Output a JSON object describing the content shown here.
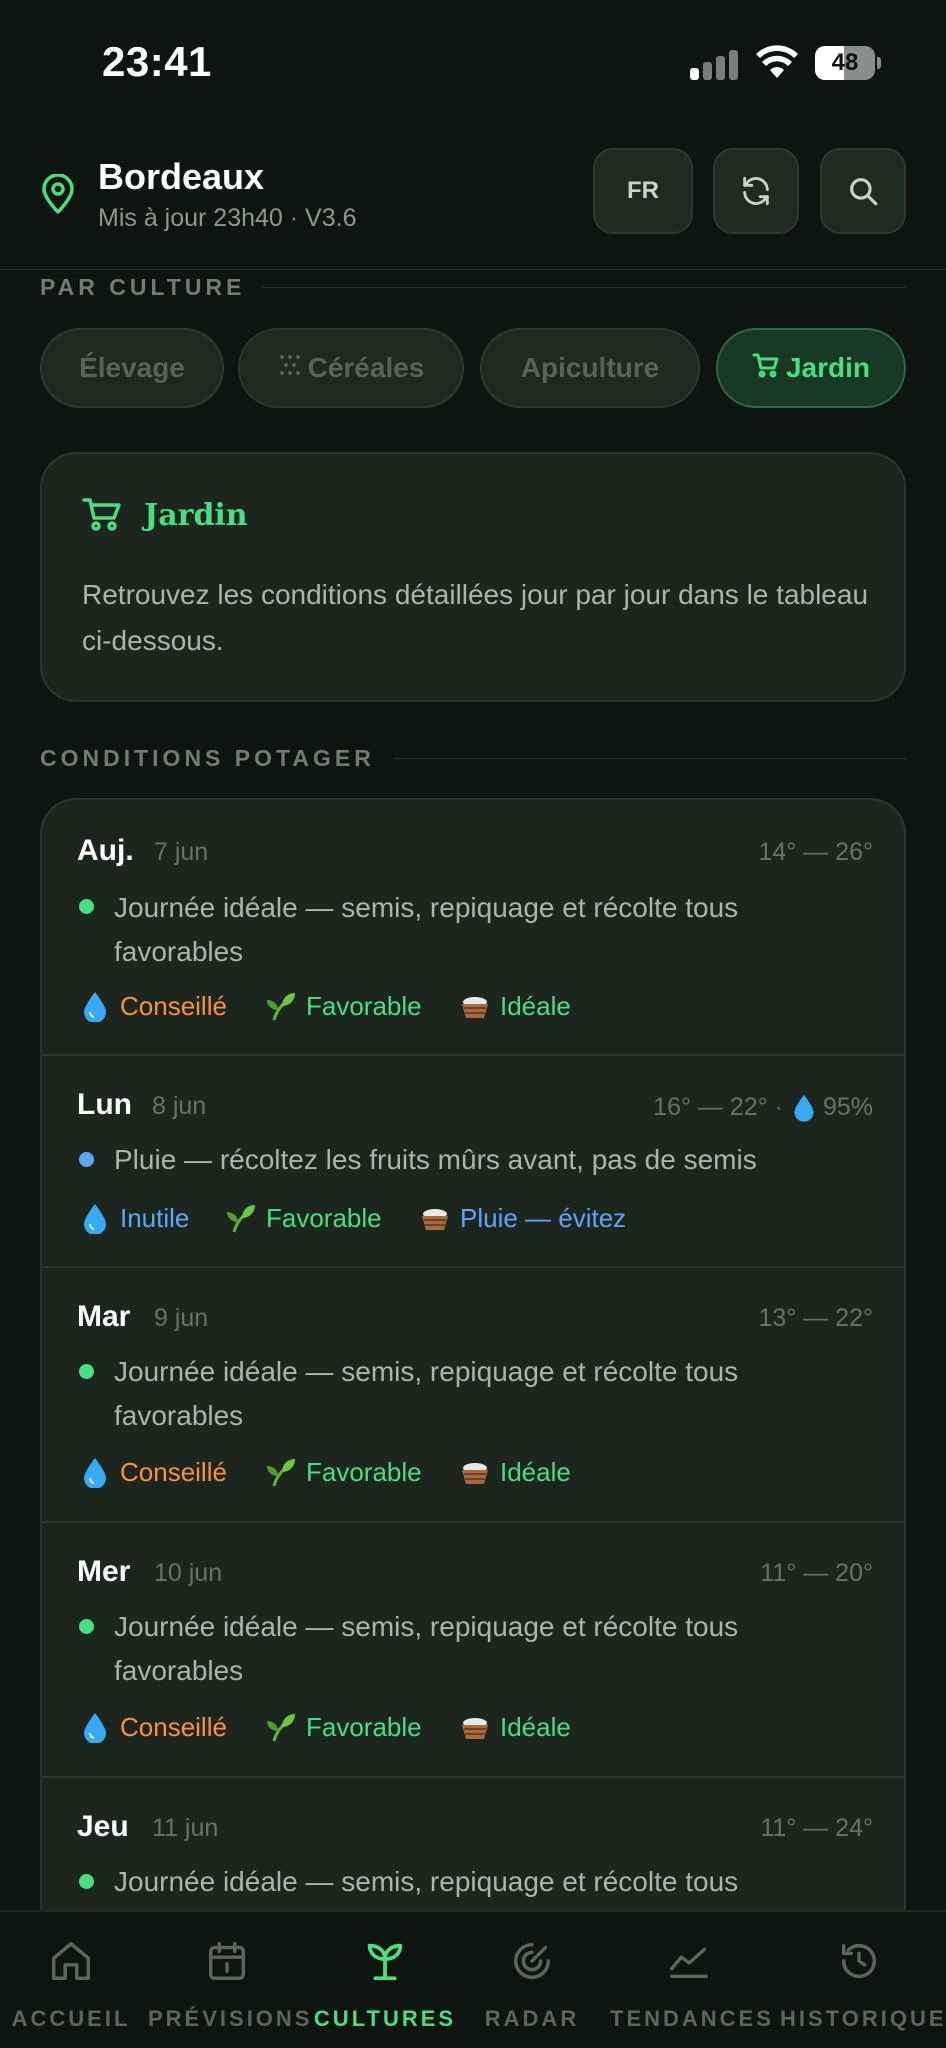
{
  "status": {
    "time": "23:41",
    "battery": "48",
    "battery_level": 0.48
  },
  "header": {
    "city": "Bordeaux",
    "updated": "Mis à jour 23h40 · V3.6",
    "lang": "FR"
  },
  "sections": {
    "by_culture": "PAR CULTURE",
    "garden_conditions": "CONDITIONS POTAGER"
  },
  "chips": [
    {
      "label": "Élevage",
      "icon": "",
      "active": false
    },
    {
      "label": "Céréales",
      "icon": "grain-icon",
      "active": false
    },
    {
      "label": "Apiculture",
      "icon": "",
      "active": false
    },
    {
      "label": "Jardin",
      "icon": "cart-icon",
      "active": true
    }
  ],
  "info": {
    "title": "Jardin",
    "icon": "wheelbarrow-icon",
    "description": "Retrouvez les conditions détaillées jour par jour dans le tableau ci-dessous."
  },
  "days": [
    {
      "day": "Auj.",
      "date": "7 jun",
      "temp": "14° — 26°",
      "rain": "",
      "status_color": "#4ade80",
      "summary": "Journée idéale — semis, repiquage et récolte tous favorables",
      "watering": "Conseillé",
      "watering_color": "#fb923c",
      "planting": "Favorable",
      "planting_color": "#4ade80",
      "harvest": "Idéale",
      "harvest_color": "#4ade80"
    },
    {
      "day": "Lun",
      "date": "8 jun",
      "temp": "16° — 22° ·",
      "rain": "95%",
      "status_color": "#60a5fa",
      "summary": "Pluie — récoltez les fruits mûrs avant, pas de semis",
      "watering": "Inutile",
      "watering_color": "#60a5fa",
      "planting": "Favorable",
      "planting_color": "#4ade80",
      "harvest": "Pluie — évitez",
      "harvest_color": "#60a5fa"
    },
    {
      "day": "Mar",
      "date": "9 jun",
      "temp": "13° — 22°",
      "rain": "",
      "status_color": "#4ade80",
      "summary": "Journée idéale — semis, repiquage et récolte tous favorables",
      "watering": "Conseillé",
      "watering_color": "#fb923c",
      "planting": "Favorable",
      "planting_color": "#4ade80",
      "harvest": "Idéale",
      "harvest_color": "#4ade80"
    },
    {
      "day": "Mer",
      "date": "10 jun",
      "temp": "11° — 20°",
      "rain": "",
      "status_color": "#4ade80",
      "summary": "Journée idéale — semis, repiquage et récolte tous favorables",
      "watering": "Conseillé",
      "watering_color": "#fb923c",
      "planting": "Favorable",
      "planting_color": "#4ade80",
      "harvest": "Idéale",
      "harvest_color": "#4ade80"
    },
    {
      "day": "Jeu",
      "date": "11 jun",
      "temp": "11° — 24°",
      "rain": "",
      "status_color": "#4ade80",
      "summary": "Journée idéale — semis, repiquage et récolte tous",
      "watering": "",
      "watering_color": "#fb923c",
      "planting": "",
      "planting_color": "#4ade80",
      "harvest": "",
      "harvest_color": "#4ade80"
    }
  ],
  "nav": [
    {
      "label": "ACCUEIL",
      "icon": "home-icon",
      "active": false
    },
    {
      "label": "PRÉVISIONS",
      "icon": "calendar-icon",
      "active": false
    },
    {
      "label": "CULTURES",
      "icon": "sprout-icon",
      "active": true
    },
    {
      "label": "RADAR",
      "icon": "radar-icon",
      "active": false
    },
    {
      "label": "TENDANCES",
      "icon": "trend-icon",
      "active": false
    },
    {
      "label": "HISTORIQUE",
      "icon": "history-icon",
      "active": false
    }
  ],
  "colors": {
    "accent": "#4ade80",
    "warn": "#fb923c",
    "info": "#60a5fa",
    "background": "#0e1510",
    "card": "#1c261f"
  }
}
